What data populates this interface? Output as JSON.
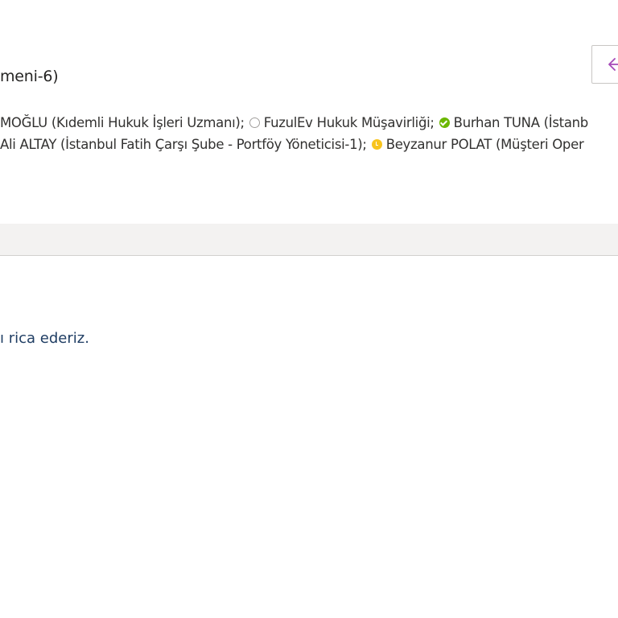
{
  "message": {
    "subject_fragment": "meni-6)",
    "recipients_row1": {
      "part1": "MOĞLU (Kıdemli Hukuk İşleri Uzmanı);",
      "part2": "FuzulEv Hukuk Müşavirliği;",
      "part3": "Burhan TUNA (İstanb"
    },
    "recipients_row2": {
      "part1": "Ali ALTAY (İstanbul Fatih Çarşı Şube - Portföy Yöneticisi-1);",
      "part2": "Beyzanur POLAT (Müşteri Oper"
    },
    "body_fragment": "ı rica ederiz."
  },
  "presence": {
    "offline_color": "#a19f9d",
    "available_color": "#6bb700",
    "away_color": "#f8c41d"
  },
  "toolbar": {
    "back_icon": "arrow-left-icon",
    "accent_color": "#a64ab8"
  }
}
